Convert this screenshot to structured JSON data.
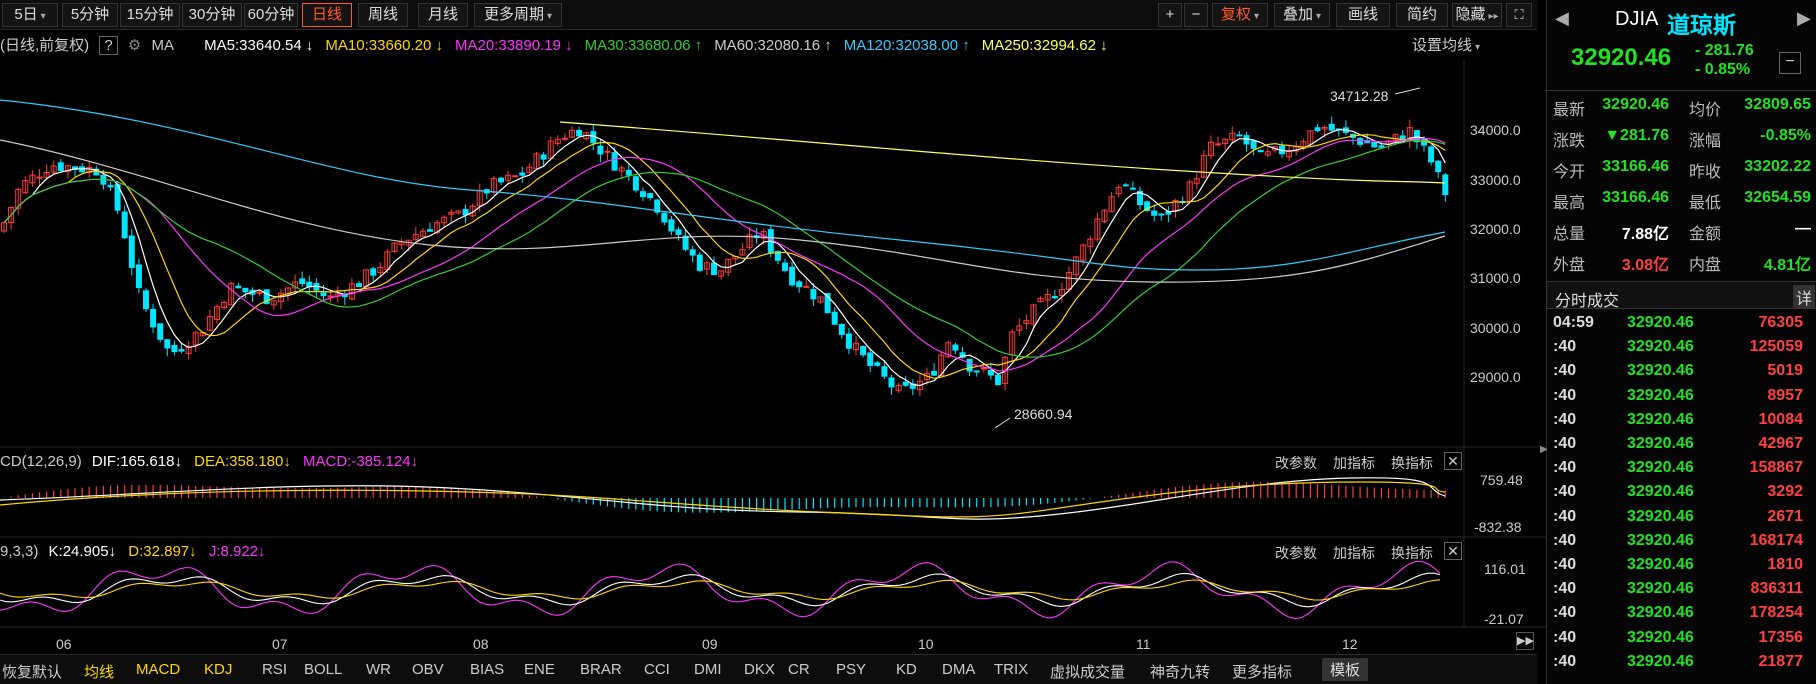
{
  "toolbar": {
    "periods": [
      "5日",
      "5分钟",
      "15分钟",
      "30分钟",
      "60分钟",
      "日线",
      "周线",
      "月线",
      "更多周期"
    ],
    "active_period": "日线",
    "plus": "+",
    "minus": "−",
    "fuquan": "复权",
    "diejia": "叠加",
    "huaxian": "画线",
    "jianyue": "简约",
    "yincang": "隐藏"
  },
  "ma_line": {
    "prefix": "(日线,前复权)",
    "help": "?",
    "ma_label": "MA",
    "items": [
      {
        "text": "MA5:33640.54",
        "arrow": "↓",
        "color": "#ffffff"
      },
      {
        "text": "MA10:33660.20",
        "arrow": "↓",
        "color": "#ffd700"
      },
      {
        "text": "MA20:33890.19",
        "arrow": "↓",
        "color": "#ff33ff"
      },
      {
        "text": "MA30:33680.06",
        "arrow": "↑",
        "color": "#33cc33"
      },
      {
        "text": "MA60:32080.16",
        "arrow": "↑",
        "color": "#cccccc"
      },
      {
        "text": "MA120:32038.00",
        "arrow": "↑",
        "color": "#33ccff"
      },
      {
        "text": "MA250:32994.62",
        "arrow": "↓",
        "color": "#ffff66"
      }
    ],
    "settings": "设置均线"
  },
  "price_axis": [
    "34000.0",
    "33000.0",
    "32000.0",
    "31000.0",
    "30000.0",
    "29000.0"
  ],
  "annotations": {
    "high": "34712.28",
    "low": "28660.94"
  },
  "macd": {
    "title": "CD(12,26,9)",
    "dif": "DIF:165.618",
    "dif_arrow": "↓",
    "dea": "DEA:358.180",
    "dea_arrow": "↓",
    "macd": "MACD:-385.124",
    "macd_arrow": "↓",
    "axis_top": "759.48",
    "axis_bottom": "-832.38"
  },
  "kdj": {
    "title": "9,3,3)",
    "k": "K:24.905",
    "k_arrow": "↓",
    "d": "D:32.897",
    "d_arrow": "↓",
    "j": "J:8.922",
    "j_arrow": "↓",
    "axis_top": "116.01",
    "axis_bottom": "-21.07"
  },
  "panel_buttons": {
    "gai": "改参数",
    "jia": "加指标",
    "huan": "换指标"
  },
  "x_axis": [
    "06",
    "07",
    "08",
    "09",
    "10",
    "11",
    "12"
  ],
  "tabs": [
    "恢复默认",
    "均线",
    "MACD",
    "KDJ",
    "RSI",
    "BOLL",
    "WR",
    "OBV",
    "BIAS",
    "ENE",
    "BRAR",
    "CCI",
    "DMI",
    "DKX",
    "CR",
    "PSY",
    "KD",
    "DMA",
    "TRIX",
    "虚拟成交量",
    "神奇九转",
    "更多指标",
    "模板"
  ],
  "quote": {
    "code": "DJIA",
    "name": "道琼斯",
    "price": "32920.46",
    "change": "- 281.76",
    "change_pct": "- 0.85%",
    "rows": [
      {
        "l1": "最新",
        "v1": "32920.46",
        "l2": "均价",
        "v2": "32809.65"
      },
      {
        "l1": "涨跌",
        "v1": "▼281.76",
        "l2": "涨幅",
        "v2": "-0.85%"
      },
      {
        "l1": "今开",
        "v1": "33166.46",
        "l2": "昨收",
        "v2": "33202.22"
      },
      {
        "l1": "最高",
        "v1": "33166.46",
        "l2": "最低",
        "v2": "32654.59"
      },
      {
        "l1": "总量",
        "v1": "7.88亿",
        "l2": "金额",
        "v2": "—"
      },
      {
        "l1": "外盘",
        "v1": "3.08亿",
        "l2": "内盘",
        "v2": "4.81亿"
      }
    ],
    "ticks_title": "分时成交",
    "ticks_detail": "详",
    "ticks": [
      {
        "t": "04:59",
        "p": "32920.46",
        "v": "76305"
      },
      {
        "t": ":40",
        "p": "32920.46",
        "v": "125059"
      },
      {
        "t": ":40",
        "p": "32920.46",
        "v": "5019"
      },
      {
        "t": ":40",
        "p": "32920.46",
        "v": "8957"
      },
      {
        "t": ":40",
        "p": "32920.46",
        "v": "10084"
      },
      {
        "t": ":40",
        "p": "32920.46",
        "v": "42967"
      },
      {
        "t": ":40",
        "p": "32920.46",
        "v": "158867"
      },
      {
        "t": ":40",
        "p": "32920.46",
        "v": "3292"
      },
      {
        "t": ":40",
        "p": "32920.46",
        "v": "2671"
      },
      {
        "t": ":40",
        "p": "32920.46",
        "v": "168174"
      },
      {
        "t": ":40",
        "p": "32920.46",
        "v": "1810"
      },
      {
        "t": ":40",
        "p": "32920.46",
        "v": "836311"
      },
      {
        "t": ":40",
        "p": "32920.46",
        "v": "178254"
      },
      {
        "t": ":40",
        "p": "32920.46",
        "v": "17356"
      },
      {
        "t": ":40",
        "p": "32920.46",
        "v": "21877"
      }
    ]
  },
  "colors": {
    "up": "#ff3a3a",
    "down": "#00e5ff",
    "accent": "#ff5a2a"
  }
}
